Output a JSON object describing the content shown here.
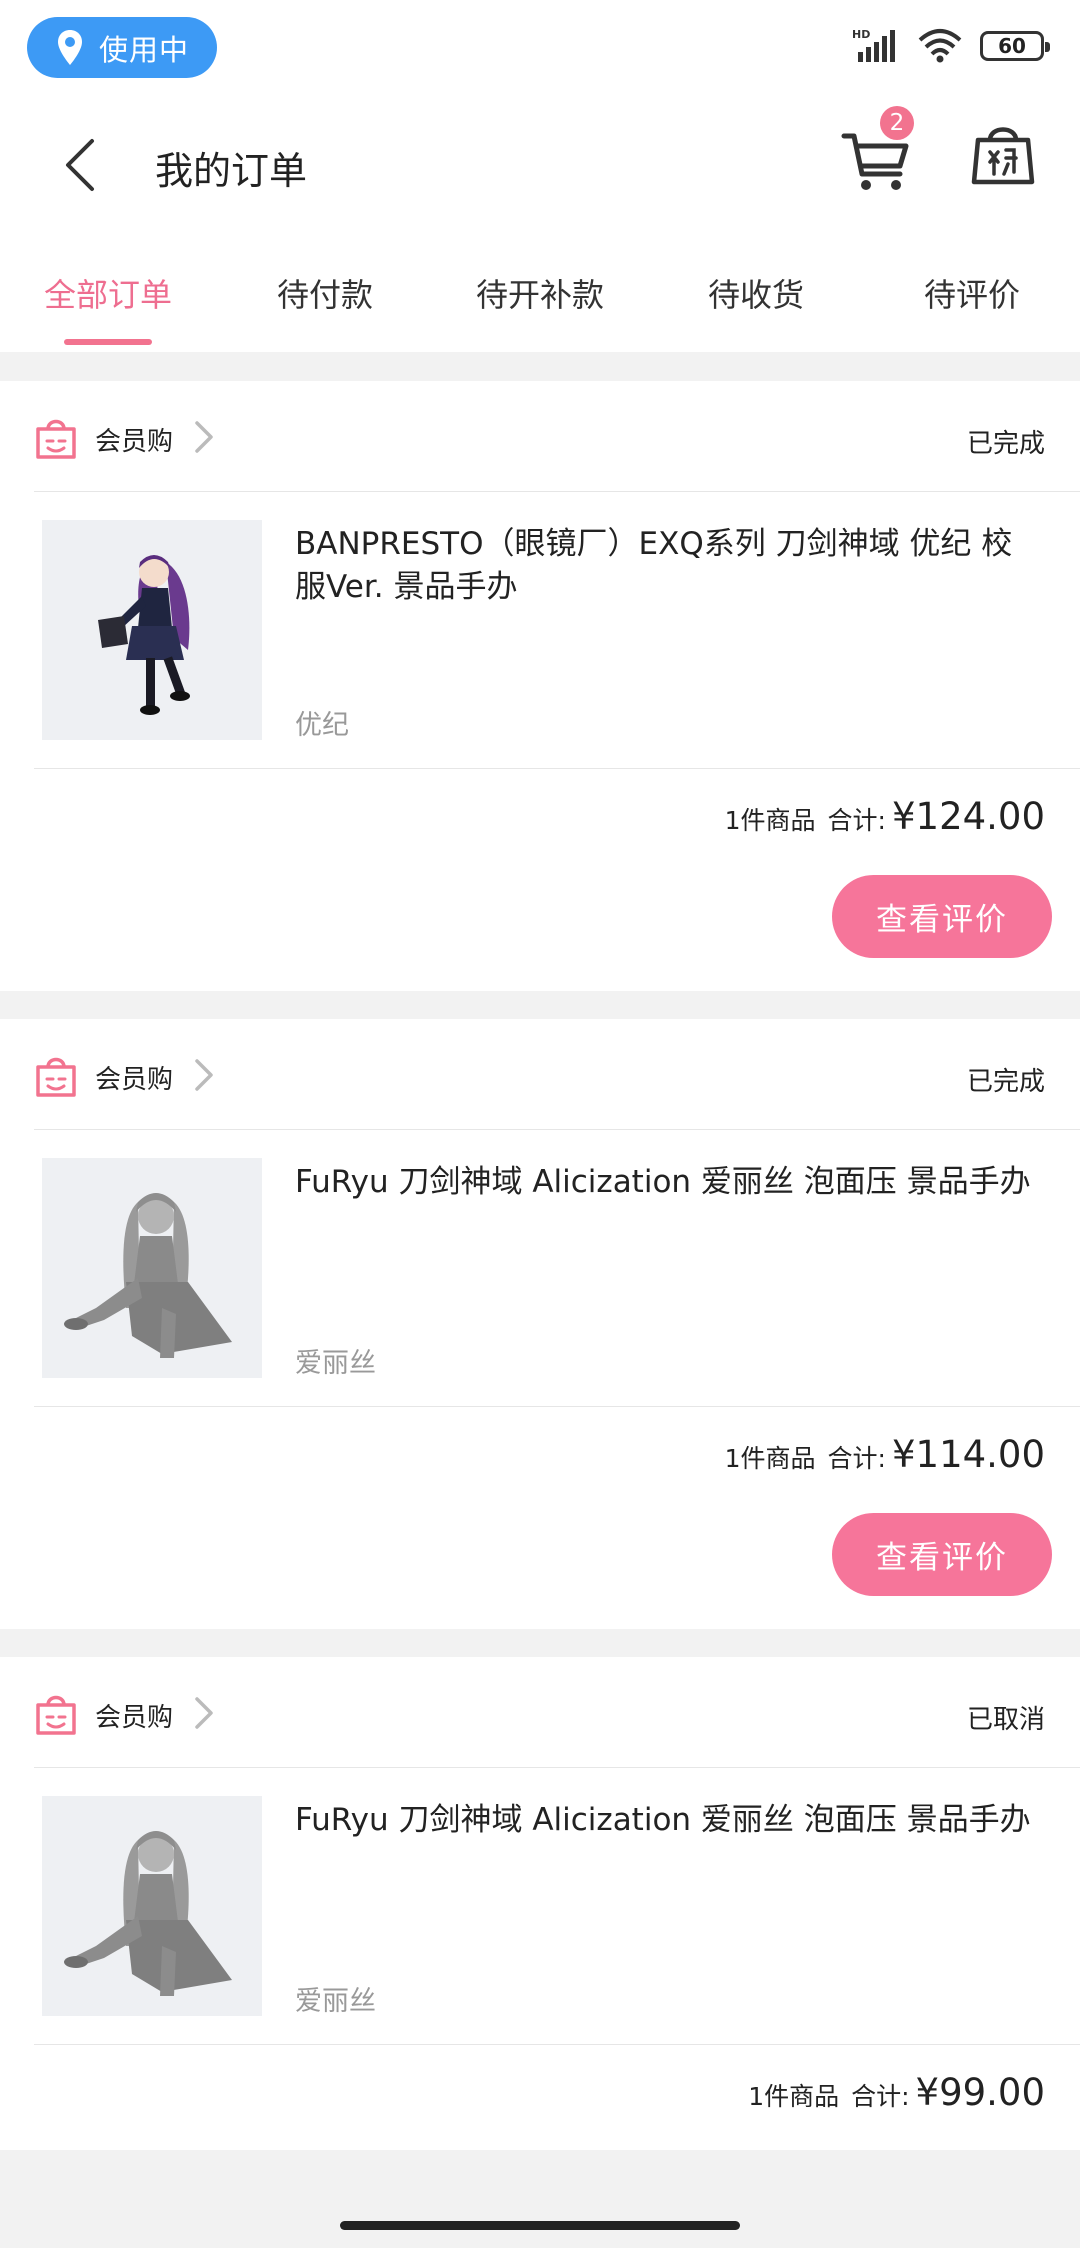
{
  "status_bar": {
    "location_label": "使用中",
    "network_label": "HD",
    "battery_level": "60"
  },
  "header": {
    "title": "我的订单",
    "cart_badge": "2"
  },
  "tabs": [
    {
      "label": "全部订单",
      "active": true
    },
    {
      "label": "待付款",
      "active": false
    },
    {
      "label": "待开补款",
      "active": false
    },
    {
      "label": "待收货",
      "active": false
    },
    {
      "label": "待评价",
      "active": false
    }
  ],
  "orders": [
    {
      "shop": "会员购",
      "status": "已完成",
      "product_title": "BANPRESTO（眼镜厂）EXQ系列 刀剑神域 优纪 校服Ver. 景品手办",
      "variant": "优纪",
      "count_label": "1件商品",
      "total_label": "合计:",
      "total_amount": "¥124.00",
      "action_label": "查看评价"
    },
    {
      "shop": "会员购",
      "status": "已完成",
      "product_title": "FuRyu 刀剑神域 Alicization 爱丽丝 泡面压 景品手办",
      "variant": "爱丽丝",
      "count_label": "1件商品",
      "total_label": "合计:",
      "total_amount": "¥114.00",
      "action_label": "查看评价"
    },
    {
      "shop": "会员购",
      "status": "已取消",
      "product_title": "FuRyu 刀剑神域 Alicization 爱丽丝 泡面压 景品手办",
      "variant": "爱丽丝",
      "count_label": "1件商品",
      "total_label": "合计:",
      "total_amount": "¥99.00"
    }
  ],
  "colors": {
    "accent": "#f2738f",
    "button": "#f6759a",
    "status_pill": "#3d9af5"
  }
}
